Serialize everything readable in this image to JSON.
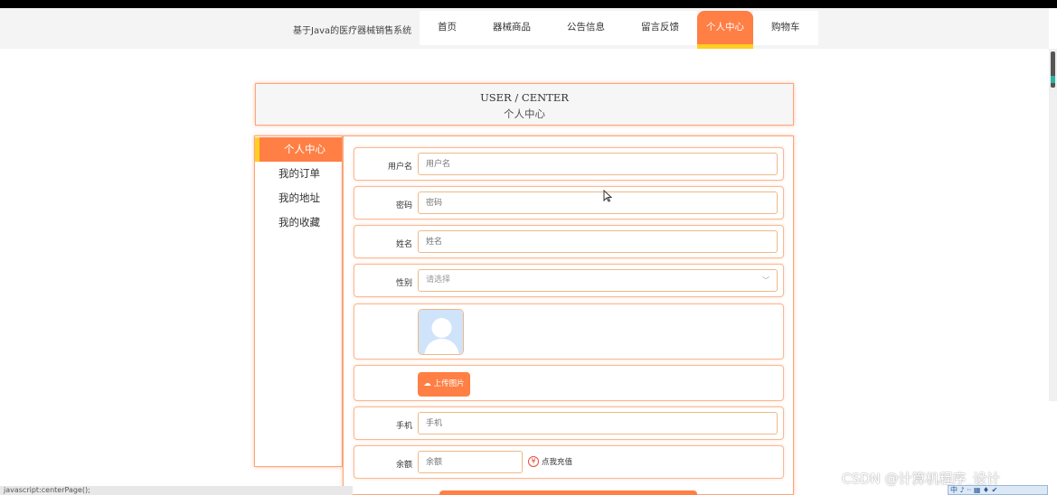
{
  "header": {
    "site_title": "基于Java的医疗器械销售系统",
    "nav": [
      "首页",
      "器械商品",
      "公告信息",
      "留言反馈",
      "个人中心",
      "购物车"
    ],
    "active_nav": "个人中心"
  },
  "banner": {
    "en": "USER / CENTER",
    "cn": "个人中心"
  },
  "sidebar": {
    "items": [
      "个人中心",
      "我的订单",
      "我的地址",
      "我的收藏"
    ]
  },
  "form": {
    "username": {
      "label": "用户名",
      "placeholder": "用户名"
    },
    "password": {
      "label": "密码",
      "placeholder": "密码"
    },
    "name": {
      "label": "姓名",
      "placeholder": "姓名"
    },
    "gender": {
      "label": "性别",
      "placeholder": "请选择"
    },
    "upload_label": "上传图片",
    "phone": {
      "label": "手机",
      "placeholder": "手机"
    },
    "balance": {
      "label": "余额",
      "placeholder": "余额"
    },
    "recharge_label": "点我充值"
  },
  "status_bar": "javascript:centerPage();",
  "watermark": "CSDN @计算机程序_设计",
  "tray": "中 ♪ ·· ▦ ♦ ✔",
  "colors": {
    "accent": "#ff7f45",
    "accent_underline": "#ffcf22",
    "border": "#f9a77c"
  }
}
